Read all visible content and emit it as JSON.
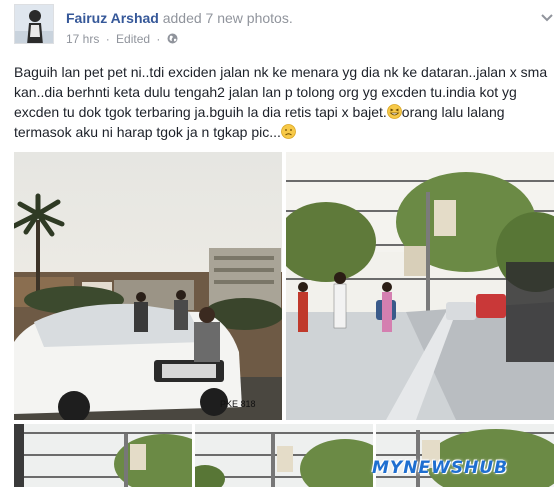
{
  "post": {
    "author": "Fairuz Arshad",
    "action": "added 7 new photos.",
    "time": "17 hrs",
    "edited": "Edited",
    "separator": "·",
    "audience_icon": "globe-icon",
    "menu_icon": "chevron-down-icon",
    "text_parts": [
      "Baguih lan pet pet ni..tdi exciden jalan nk ke menara yg dia nk ke dataran..jalan x sma kan..dia berhnti keta dulu tengah2 jalan lan p tolong org yg excden tu.india kot yg excden tu dok tgok terbaring ja.bguih la dia retis tapi x bajet.",
      "orang lalu lalang termasok aku ni harap tgok ja n tgkap pic..."
    ],
    "emojis": [
      "grinning-face-icon",
      "disappointed-face-icon"
    ]
  },
  "photos": [
    {
      "name": "photo-street-accident",
      "plate": "PKE 818"
    },
    {
      "name": "photo-road-crossing"
    },
    {
      "name": "photo-thumb-1"
    },
    {
      "name": "photo-thumb-2"
    },
    {
      "name": "photo-thumb-3"
    }
  ],
  "watermark": "MYNEWSHUB",
  "colors": {
    "author": "#365899",
    "meta": "#90949c",
    "text": "#1d2129",
    "watermark": "#1f6fd0"
  }
}
